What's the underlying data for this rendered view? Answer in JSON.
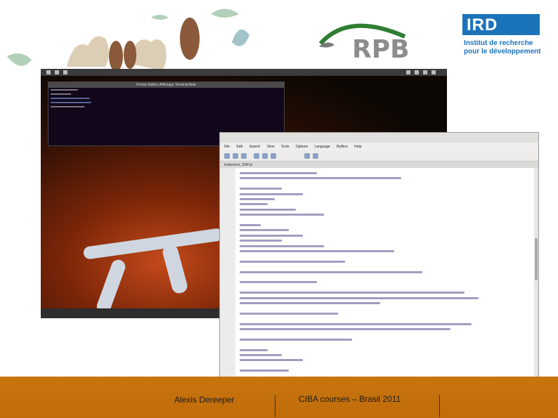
{
  "logos": {
    "rpb": "RPB",
    "ird_acronym": "IRD",
    "ird_tagline_1": "Institut de recherche",
    "ird_tagline_2": "pour le développement"
  },
  "terminal": {
    "title": "Fichier Edition Affichage Terminal Aide"
  },
  "editor": {
    "menu": [
      "File",
      "Edit",
      "Search",
      "View",
      "Tools",
      "Options",
      "Language",
      "Buffers",
      "Help"
    ],
    "tab_label": "traitement_SNP.pl"
  },
  "footer": {
    "author": "Alexis Dereeper",
    "course": "CIBA courses – Brasil 2011"
  },
  "colors": {
    "footer_bg": "#c7750f",
    "ird_blue": "#1b73ba"
  }
}
